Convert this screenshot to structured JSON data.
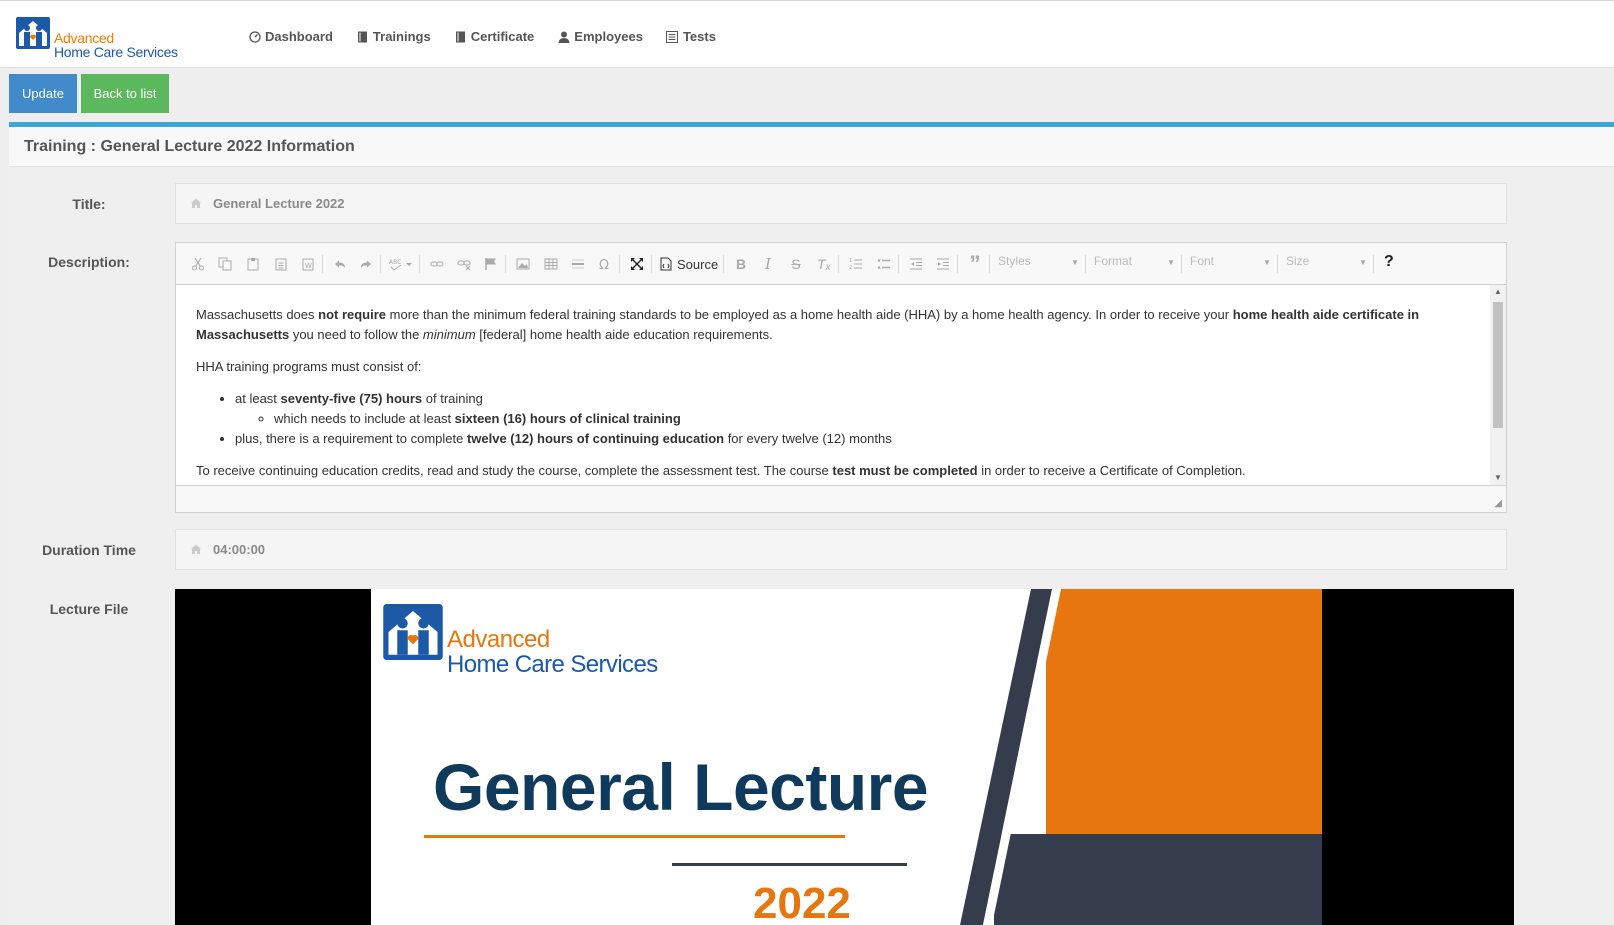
{
  "brand": {
    "line1": "Advanced",
    "line2": "Home Care Services"
  },
  "nav": [
    {
      "label": "Dashboard",
      "icon": "dashboard-icon"
    },
    {
      "label": "Trainings",
      "icon": "book-icon"
    },
    {
      "label": "Certificate",
      "icon": "book-icon"
    },
    {
      "label": "Employees",
      "icon": "user-icon"
    },
    {
      "label": "Tests",
      "icon": "list-icon"
    }
  ],
  "actions": {
    "update_label": "Update",
    "back_label": "Back to list"
  },
  "panel": {
    "title": "Training : General Lecture 2022 Information"
  },
  "form": {
    "title_label": "Title:",
    "title_value": "General Lecture 2022",
    "description_label": "Description:",
    "duration_label": "Duration Time",
    "duration_value": "04:00:00",
    "lecture_label": "Lecture File"
  },
  "editor": {
    "source_label": "Source",
    "styles_label": "Styles",
    "format_label": "Format",
    "font_label": "Font",
    "size_label": "Size",
    "help_label": "?",
    "content": {
      "p1_a": "Massachusetts does ",
      "p1_b": "not require",
      "p1_c": " more than the minimum federal training standards to be employed as a home health aide (HHA) by a  home health agency. In order to receive your ",
      "p1_d": "home health aide certificate in Massachusetts",
      "p1_e": " you need to follow the ",
      "p1_f": "minimum",
      "p1_g": " [federal] home health aide education requirements.",
      "p2": "HHA training programs must consist of:",
      "li1_a": "at least ",
      "li1_b": "seventy-five (75) hours",
      "li1_c": " of training",
      "li1_sub_a": "which needs to include at least ",
      "li1_sub_b": "sixteen (16) hours of clinical training",
      "li2_a": "plus, there is a requirement to complete ",
      "li2_b": "twelve (12) hours of continuing education",
      "li2_c": " for every twelve (12) months",
      "p3_a": "To receive continuing education credits, read and study the course, complete the assessment test. The course ",
      "p3_b": "test must be completed",
      "p3_c": " in order to receive a Certificate of Completion."
    }
  },
  "video_slide": {
    "logo_line1": "Advanced",
    "logo_line2": "Home Care Services",
    "title": "General Lecture",
    "year": "2022"
  },
  "colors": {
    "primary": "#428bca",
    "success": "#5cb85c",
    "accent": "#3da6d8",
    "brand_orange": "#e8760f",
    "brand_blue": "#1c5aa8"
  }
}
